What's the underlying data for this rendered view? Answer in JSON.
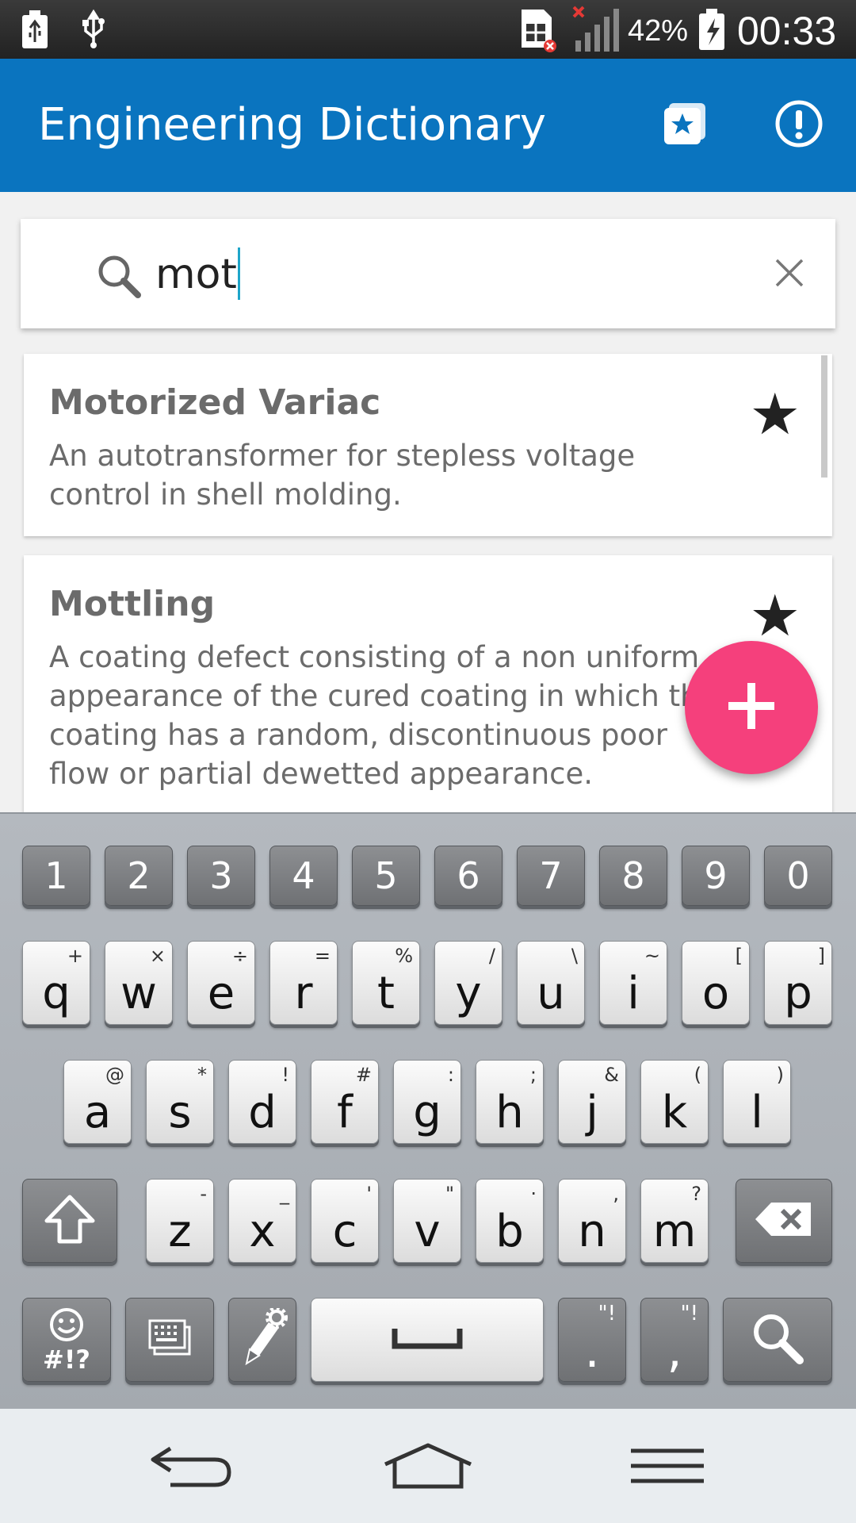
{
  "status_bar": {
    "battery_percent": "42%",
    "time": "00:33",
    "icons": [
      "usb-charging-icon",
      "usb-icon",
      "sim-error-icon",
      "no-signal-icon",
      "battery-charging-icon"
    ]
  },
  "app_bar": {
    "title": "Engineering Dictionary",
    "actions": [
      "favorites-icon",
      "info-icon"
    ]
  },
  "search": {
    "value": "mot",
    "icon": "search-icon",
    "clear_icon": "close-icon"
  },
  "results": [
    {
      "title": "Motorized Variac",
      "description": "An autotransformer for stepless voltage control in shell molding.",
      "starred": true
    },
    {
      "title": "Mottling",
      "description": "A coating defect consisting of a non uniform appearance of the cured coating in which the coating has a random, discontinuous poor flow or partial dewetted appearance.",
      "starred": true
    }
  ],
  "fab": {
    "icon": "add-icon"
  },
  "keyboard": {
    "numbers": [
      "1",
      "2",
      "3",
      "4",
      "5",
      "6",
      "7",
      "8",
      "9",
      "0"
    ],
    "row1": [
      {
        "k": "q",
        "a": "+"
      },
      {
        "k": "w",
        "a": "×"
      },
      {
        "k": "e",
        "a": "÷"
      },
      {
        "k": "r",
        "a": "="
      },
      {
        "k": "t",
        "a": "%"
      },
      {
        "k": "y",
        "a": "/"
      },
      {
        "k": "u",
        "a": "\\"
      },
      {
        "k": "i",
        "a": "~"
      },
      {
        "k": "o",
        "a": "["
      },
      {
        "k": "p",
        "a": "]"
      }
    ],
    "row2": [
      {
        "k": "a",
        "a": "@"
      },
      {
        "k": "s",
        "a": "*"
      },
      {
        "k": "d",
        "a": "!"
      },
      {
        "k": "f",
        "a": "#"
      },
      {
        "k": "g",
        "a": ":"
      },
      {
        "k": "h",
        "a": ";"
      },
      {
        "k": "j",
        "a": "&"
      },
      {
        "k": "k",
        "a": "("
      },
      {
        "k": "l",
        "a": ")"
      }
    ],
    "row3": [
      {
        "k": "z",
        "a": "-"
      },
      {
        "k": "x",
        "a": "_"
      },
      {
        "k": "c",
        "a": "'"
      },
      {
        "k": "v",
        "a": "\""
      },
      {
        "k": "b",
        "a": "·"
      },
      {
        "k": "n",
        "a": ","
      },
      {
        "k": "m",
        "a": "?"
      }
    ],
    "symbols_label": "#!?",
    "period": ".",
    "period_alt": "\"!",
    "comma": ",",
    "comma_alt": "\"!"
  },
  "nav_bar": [
    "back-icon",
    "home-icon",
    "menu-icon"
  ],
  "colors": {
    "app_bar": "#0a74bf",
    "fab": "#f5407c",
    "caret": "#1ea5c9"
  }
}
